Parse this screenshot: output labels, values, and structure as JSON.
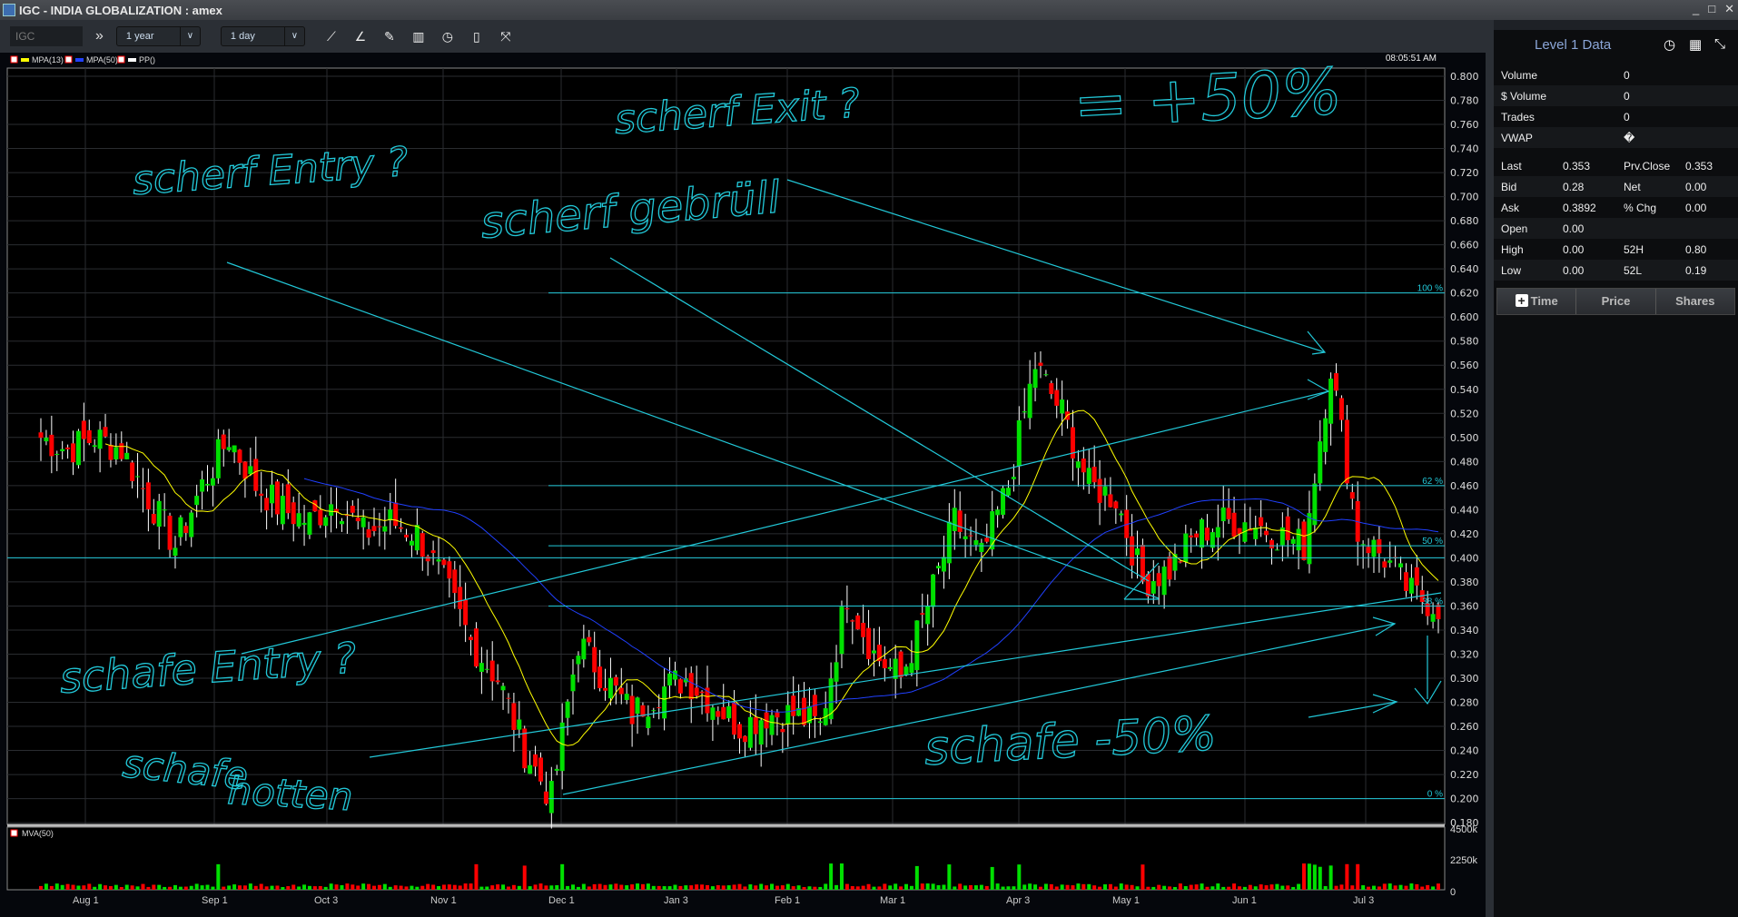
{
  "window": {
    "title": "IGC - INDIA GLOBALIZATION : amex",
    "controls": [
      "_",
      "□",
      "✕"
    ]
  },
  "toolbar": {
    "symbol": "IGC",
    "range": "1 year",
    "interval": "1 day",
    "icons": [
      "line-chart-icon",
      "study-chart-icon",
      "brush-icon",
      "bar-chart-icon",
      "clock-icon",
      "document-icon",
      "fullscreen-icon"
    ]
  },
  "chart": {
    "time": "08:05:51 AM",
    "legend": [
      {
        "label": "MPA(13)",
        "color": "#ffff00"
      },
      {
        "label": "MPA(50)",
        "color": "#2040ff"
      },
      {
        "label": "PP()",
        "color": "#ffffff"
      }
    ],
    "volume_legend": "MVA(50)",
    "y_ticks": [
      "0.800",
      "0.780",
      "0.760",
      "0.740",
      "0.720",
      "0.700",
      "0.680",
      "0.660",
      "0.640",
      "0.620",
      "0.600",
      "0.580",
      "0.560",
      "0.540",
      "0.520",
      "0.500",
      "0.480",
      "0.460",
      "0.440",
      "0.420",
      "0.400",
      "0.380",
      "0.360",
      "0.340",
      "0.320",
      "0.300",
      "0.280",
      "0.260",
      "0.240",
      "0.220",
      "0.200",
      "0.180"
    ],
    "vol_ticks": [
      "4500k",
      "2250k",
      "0"
    ],
    "x_ticks": [
      "Aug 1",
      "Sep 1",
      "Oct 3",
      "Nov 1",
      "Dec 1",
      "Jan 3",
      "Feb 1",
      "Mar 1",
      "Apr 3",
      "May 1",
      "Jun 1",
      "Jul 3"
    ],
    "fib": [
      {
        "label": "100 %",
        "value": 0.62
      },
      {
        "label": "62 %",
        "value": 0.46
      },
      {
        "label": "50 %",
        "value": 0.41
      },
      {
        "label": "38 %",
        "value": 0.36
      },
      {
        "label": "0 %",
        "value": 0.2
      }
    ],
    "hline": 0.4,
    "up_color": "#00e000",
    "down_color": "#ff0000",
    "drawing_color": "#22c8d8",
    "weekly_closes": [
      0.5,
      0.49,
      0.5,
      0.49,
      0.45,
      0.41,
      0.46,
      0.5,
      0.46,
      0.44,
      0.43,
      0.45,
      0.42,
      0.43,
      0.42,
      0.38,
      0.33,
      0.3,
      0.24,
      0.2,
      0.33,
      0.3,
      0.27,
      0.29,
      0.3,
      0.28,
      0.26,
      0.27,
      0.27,
      0.26,
      0.37,
      0.32,
      0.3,
      0.36,
      0.43,
      0.4,
      0.46,
      0.56,
      0.52,
      0.46,
      0.45,
      0.38,
      0.39,
      0.42,
      0.43,
      0.43,
      0.42,
      0.41,
      0.56,
      0.42,
      0.4,
      0.37,
      0.36
    ],
    "annotations": [
      "scherf Entry ?",
      "scherf Exit ?",
      "= +50%",
      "scherf gebrüll",
      "schafe Entry ?",
      "schafe",
      "hotten",
      "schafe -50%"
    ]
  },
  "level1": {
    "title": "Level 1 Data",
    "single": [
      {
        "label": "Volume",
        "value": "0"
      },
      {
        "label": "$ Volume",
        "value": "0"
      },
      {
        "label": " Trades",
        "value": "0"
      },
      {
        "label": " VWAP",
        "value": "�"
      }
    ],
    "grid": [
      [
        "Last",
        "0.353",
        "Prv.Close",
        "0.353"
      ],
      [
        "Bid",
        "0.28",
        "Net",
        "0.00"
      ],
      [
        "Ask",
        "0.3892",
        "% Chg",
        "0.00"
      ],
      [
        "Open",
        "0.00",
        "",
        ""
      ],
      [
        "High",
        "0.00",
        "52H",
        "0.80"
      ],
      [
        "Low",
        "0.00",
        "52L",
        "0.19"
      ]
    ],
    "columns": [
      "Time",
      "Price",
      "Shares"
    ]
  }
}
